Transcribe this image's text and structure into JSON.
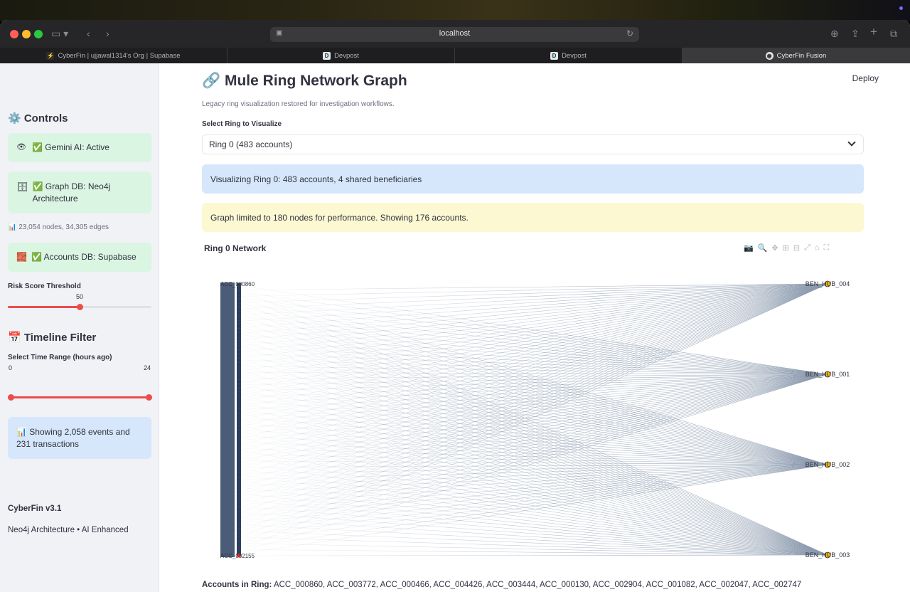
{
  "browser": {
    "url": "localhost",
    "tabs": [
      {
        "label": "CyberFin | ujjawal1314's Org | Supabase",
        "icon": "supabase-icon",
        "active": false
      },
      {
        "label": "Devpost",
        "icon": "devpost-icon",
        "active": false
      },
      {
        "label": "Devpost",
        "icon": "devpost-icon",
        "active": false
      },
      {
        "label": "CyberFin Fusion",
        "icon": "cyberfin-icon",
        "active": true
      }
    ]
  },
  "sidebar": {
    "controls_heading": "⚙️ Controls",
    "gemini_status": "✅ Gemini AI: Active",
    "graph_db_status": "✅ Graph DB: Neo4j Architecture",
    "graph_stats": "📊 23,054 nodes, 34,305 edges",
    "accounts_db_status": "✅ Accounts DB: Supabase",
    "risk_label": "Risk Score Threshold",
    "risk_value": "50",
    "risk_fraction": 0.5,
    "timeline_heading": "📅 Timeline Filter",
    "time_range_label": "Select Time Range (hours ago)",
    "time_min": "0",
    "time_max": "24",
    "showing_text": "📊 Showing 2,058 events and 231 transactions",
    "version": "CyberFin v3.1",
    "tagline": "Neo4j Architecture • AI Enhanced"
  },
  "main": {
    "deploy_label": "Deploy",
    "title": "🔗 Mule Ring Network Graph",
    "caption": "Legacy ring visualization restored for investigation workflows.",
    "select_label": "Select Ring to Visualize",
    "select_value": "Ring 0 (483 accounts)",
    "info_banner": "Visualizing Ring 0: 483 accounts, 4 shared beneficiaries",
    "warning_banner": "Graph limited to 180 nodes for performance. Showing 176 accounts.",
    "graph_title": "Ring 0 Network",
    "accounts_label": "Accounts in Ring:",
    "accounts_list": "ACC_000860, ACC_003772, ACC_000466, ACC_004426, ACC_003444, ACC_000130, ACC_002904, ACC_001082, ACC_002047, ACC_002747"
  },
  "graph": {
    "account_count": 176,
    "top_account_label": "ACC_000860",
    "bottom_account_label": "ACC_002155",
    "beneficiaries": [
      "BEN_HUB_004",
      "BEN_HUB_001",
      "BEN_HUB_002",
      "BEN_HUB_003"
    ],
    "edge_color": "#8a99ad",
    "account_color": "#2a3f5f",
    "beneficiary_color": "#f2b50f"
  },
  "colors": {
    "accent": "#ee4b4b",
    "success_bg": "#dbf5e3",
    "info_bg": "#d6e7fb",
    "warning_bg": "#fbf8d2"
  }
}
